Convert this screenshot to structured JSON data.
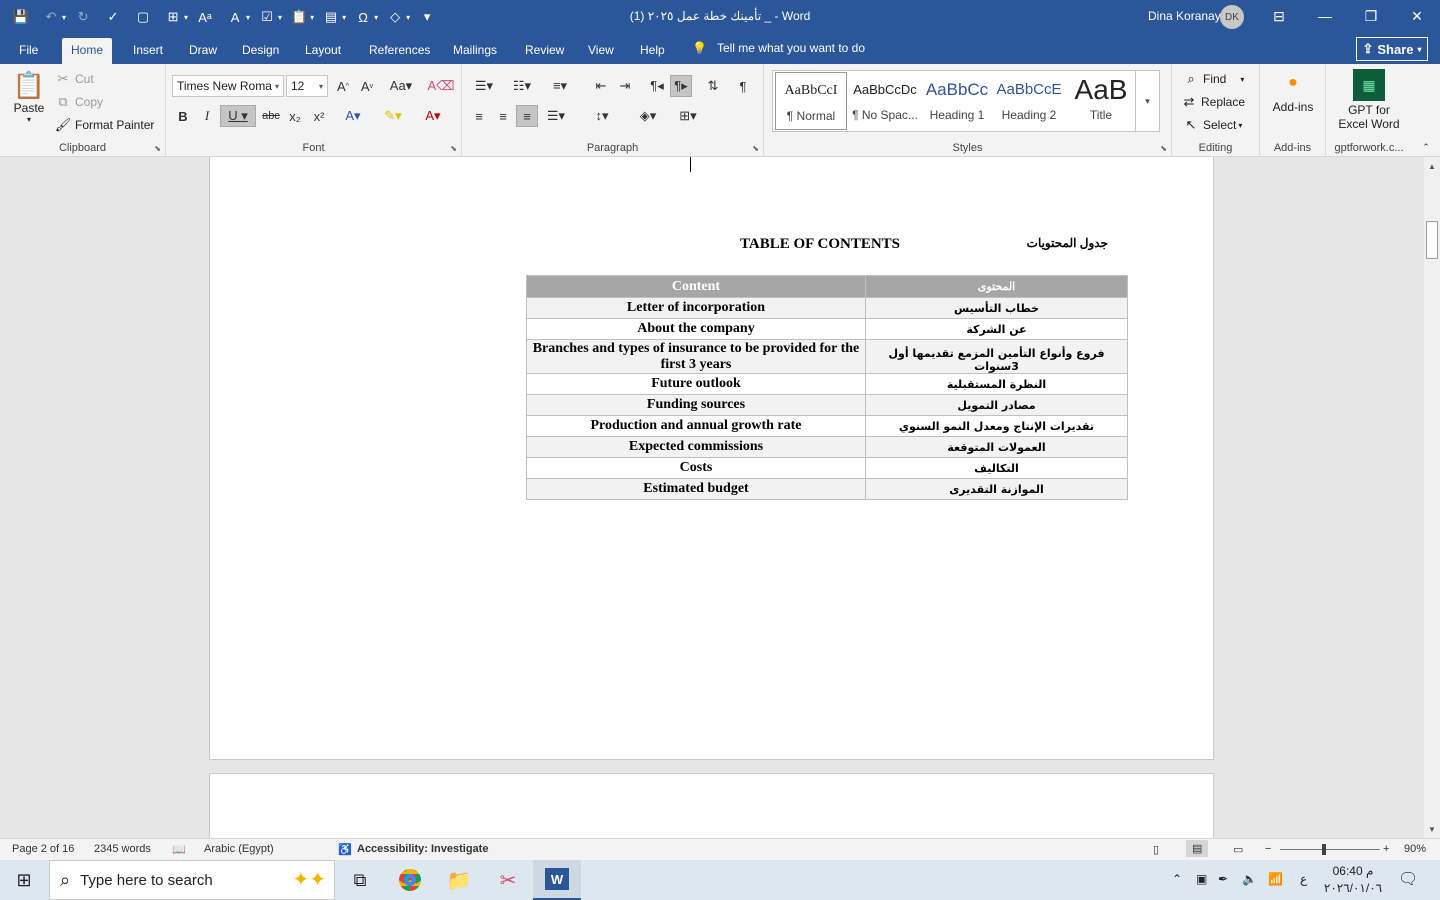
{
  "window": {
    "title": "تأمينك خطة عمل ٢٠٢٥ (1)  _  -  Word",
    "user_name": "Dina Koranay",
    "user_initials": "DK"
  },
  "tabs": [
    "File",
    "Home",
    "Insert",
    "Draw",
    "Design",
    "Layout",
    "References",
    "Mailings",
    "Review",
    "View",
    "Help"
  ],
  "tell_me": "Tell me what you want to do",
  "share_label": "Share",
  "clipboard": {
    "paste": "Paste",
    "cut": "Cut",
    "copy": "Copy",
    "format_painter": "Format Painter",
    "label": "Clipboard"
  },
  "font": {
    "family": "Times New Roma",
    "size": "12",
    "label": "Font"
  },
  "paragraph": {
    "label": "Paragraph"
  },
  "styles": {
    "label": "Styles",
    "items": [
      {
        "preview": "AaBbCcI",
        "name": "¶ Normal"
      },
      {
        "preview": "AaBbCcDc",
        "name": "¶ No Spac..."
      },
      {
        "preview": "AaBbCc",
        "name": "Heading 1"
      },
      {
        "preview": "AaBbCcE",
        "name": "Heading 2"
      },
      {
        "preview": "AaB",
        "name": "Title"
      }
    ]
  },
  "editing": {
    "find": "Find",
    "replace": "Replace",
    "select": "Select",
    "label": "Editing"
  },
  "addins": {
    "button": "Add-ins",
    "label": "Add-ins",
    "gpt_line1": "GPT for",
    "gpt_line2": "Excel Word",
    "gpt_label": "gptforwork.c..."
  },
  "document": {
    "toc_title": "TABLE OF CONTENTS",
    "toc_title_ar": "جدول المحتويات",
    "header_en": "Content",
    "header_ar": "المحتوى",
    "rows": [
      {
        "en": "Letter of incorporation",
        "ar": "خطاب التأسيس"
      },
      {
        "en": "About the company",
        "ar": "عن الشركة"
      },
      {
        "en": "Branches and types of insurance to be provided for the first 3 years",
        "ar": "فروع وأنواع التأمين المزمع تقديمها أول 3سنوات"
      },
      {
        "en": "Future outlook",
        "ar": "النظرة المستقبلية"
      },
      {
        "en": "Funding sources",
        "ar": "مصادر التمويل"
      },
      {
        "en": "Production and annual growth rate",
        "ar": "تقديرات الإنتاج ومعدل النمو السنوي"
      },
      {
        "en": "Expected commissions",
        "ar": "العمولات المتوقعة"
      },
      {
        "en": "Costs",
        "ar": "التكاليف"
      },
      {
        "en": "Estimated budget",
        "ar": "الموازنة التقديرى"
      }
    ]
  },
  "status": {
    "page": "Page 2 of 16",
    "words": "2345 words",
    "language": "Arabic (Egypt)",
    "accessibility": "Accessibility: Investigate",
    "zoom": "90%"
  },
  "taskbar": {
    "search_placeholder": "Type here to search",
    "time": "06:40 م",
    "date": "٢٠٢٦/٠١/٠٦",
    "lang": "ع"
  }
}
